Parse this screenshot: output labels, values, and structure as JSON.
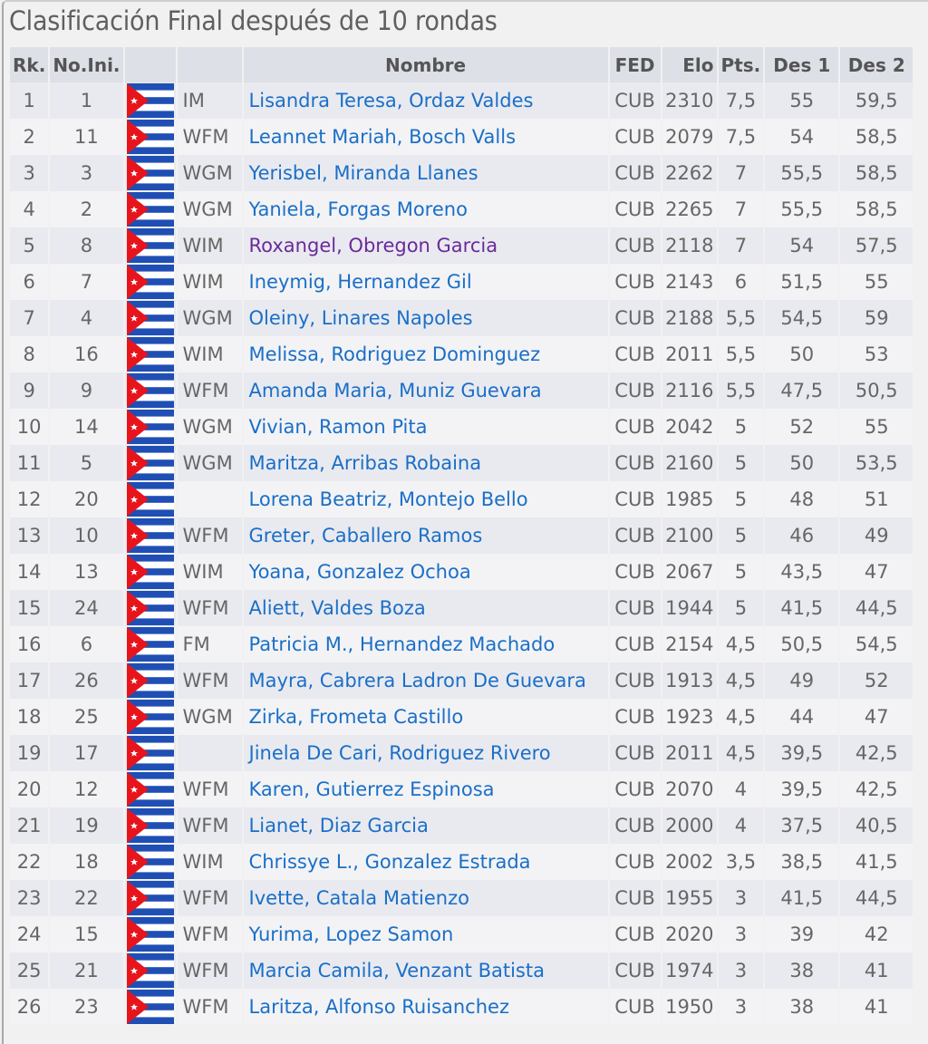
{
  "title": "Clasificación Final después de 10 rondas",
  "colors": {
    "link": "#1a6fc7",
    "visited_link": "#6a2a9a",
    "header_bg": "#dde0e6",
    "row_odd_bg": "#e9eaf0",
    "row_even_bg": "#f3f3f5",
    "flag_blue": "#1f4fb4",
    "flag_red": "#e8141c"
  },
  "table": {
    "columns": {
      "rank": "Rk.",
      "start_no": "No.Ini.",
      "flag": "",
      "title": "",
      "name": "Nombre",
      "fed": "FED",
      "elo": "Elo",
      "pts": "Pts.",
      "tb1": "Des 1",
      "tb2": "Des 2"
    },
    "rows": [
      {
        "rank": "1",
        "start_no": "1",
        "flag": "cuba-flag-icon",
        "title": "IM",
        "name": "Lisandra Teresa, Ordaz Valdes",
        "visited": false,
        "fed": "CUB",
        "elo": "2310",
        "pts": "7,5",
        "tb1": "55",
        "tb2": "59,5"
      },
      {
        "rank": "2",
        "start_no": "11",
        "flag": "cuba-flag-icon",
        "title": "WFM",
        "name": "Leannet Mariah, Bosch Valls",
        "visited": false,
        "fed": "CUB",
        "elo": "2079",
        "pts": "7,5",
        "tb1": "54",
        "tb2": "58,5"
      },
      {
        "rank": "3",
        "start_no": "3",
        "flag": "cuba-flag-icon",
        "title": "WGM",
        "name": "Yerisbel, Miranda Llanes",
        "visited": false,
        "fed": "CUB",
        "elo": "2262",
        "pts": "7",
        "tb1": "55,5",
        "tb2": "58,5"
      },
      {
        "rank": "4",
        "start_no": "2",
        "flag": "cuba-flag-icon",
        "title": "WGM",
        "name": "Yaniela, Forgas Moreno",
        "visited": false,
        "fed": "CUB",
        "elo": "2265",
        "pts": "7",
        "tb1": "55,5",
        "tb2": "58,5"
      },
      {
        "rank": "5",
        "start_no": "8",
        "flag": "cuba-flag-icon",
        "title": "WIM",
        "name": "Roxangel, Obregon Garcia",
        "visited": true,
        "fed": "CUB",
        "elo": "2118",
        "pts": "7",
        "tb1": "54",
        "tb2": "57,5"
      },
      {
        "rank": "6",
        "start_no": "7",
        "flag": "cuba-flag-icon",
        "title": "WIM",
        "name": "Ineymig, Hernandez Gil",
        "visited": false,
        "fed": "CUB",
        "elo": "2143",
        "pts": "6",
        "tb1": "51,5",
        "tb2": "55"
      },
      {
        "rank": "7",
        "start_no": "4",
        "flag": "cuba-flag-icon",
        "title": "WGM",
        "name": "Oleiny, Linares Napoles",
        "visited": false,
        "fed": "CUB",
        "elo": "2188",
        "pts": "5,5",
        "tb1": "54,5",
        "tb2": "59"
      },
      {
        "rank": "8",
        "start_no": "16",
        "flag": "cuba-flag-icon",
        "title": "WIM",
        "name": "Melissa, Rodriguez Dominguez",
        "visited": false,
        "fed": "CUB",
        "elo": "2011",
        "pts": "5,5",
        "tb1": "50",
        "tb2": "53"
      },
      {
        "rank": "9",
        "start_no": "9",
        "flag": "cuba-flag-icon",
        "title": "WFM",
        "name": "Amanda Maria, Muniz Guevara",
        "visited": false,
        "fed": "CUB",
        "elo": "2116",
        "pts": "5,5",
        "tb1": "47,5",
        "tb2": "50,5"
      },
      {
        "rank": "10",
        "start_no": "14",
        "flag": "cuba-flag-icon",
        "title": "WGM",
        "name": "Vivian, Ramon Pita",
        "visited": false,
        "fed": "CUB",
        "elo": "2042",
        "pts": "5",
        "tb1": "52",
        "tb2": "55"
      },
      {
        "rank": "11",
        "start_no": "5",
        "flag": "cuba-flag-icon",
        "title": "WGM",
        "name": "Maritza, Arribas Robaina",
        "visited": false,
        "fed": "CUB",
        "elo": "2160",
        "pts": "5",
        "tb1": "50",
        "tb2": "53,5"
      },
      {
        "rank": "12",
        "start_no": "20",
        "flag": "cuba-flag-icon",
        "title": "",
        "name": "Lorena Beatriz, Montejo Bello",
        "visited": false,
        "fed": "CUB",
        "elo": "1985",
        "pts": "5",
        "tb1": "48",
        "tb2": "51"
      },
      {
        "rank": "13",
        "start_no": "10",
        "flag": "cuba-flag-icon",
        "title": "WFM",
        "name": "Greter, Caballero Ramos",
        "visited": false,
        "fed": "CUB",
        "elo": "2100",
        "pts": "5",
        "tb1": "46",
        "tb2": "49"
      },
      {
        "rank": "14",
        "start_no": "13",
        "flag": "cuba-flag-icon",
        "title": "WIM",
        "name": "Yoana, Gonzalez Ochoa",
        "visited": false,
        "fed": "CUB",
        "elo": "2067",
        "pts": "5",
        "tb1": "43,5",
        "tb2": "47"
      },
      {
        "rank": "15",
        "start_no": "24",
        "flag": "cuba-flag-icon",
        "title": "WFM",
        "name": "Aliett, Valdes Boza",
        "visited": false,
        "fed": "CUB",
        "elo": "1944",
        "pts": "5",
        "tb1": "41,5",
        "tb2": "44,5"
      },
      {
        "rank": "16",
        "start_no": "6",
        "flag": "cuba-flag-icon",
        "title": "FM",
        "name": "Patricia M., Hernandez Machado",
        "visited": false,
        "fed": "CUB",
        "elo": "2154",
        "pts": "4,5",
        "tb1": "50,5",
        "tb2": "54,5"
      },
      {
        "rank": "17",
        "start_no": "26",
        "flag": "cuba-flag-icon",
        "title": "WFM",
        "name": "Mayra, Cabrera Ladron De Guevara",
        "visited": false,
        "fed": "CUB",
        "elo": "1913",
        "pts": "4,5",
        "tb1": "49",
        "tb2": "52"
      },
      {
        "rank": "18",
        "start_no": "25",
        "flag": "cuba-flag-icon",
        "title": "WGM",
        "name": "Zirka, Frometa Castillo",
        "visited": false,
        "fed": "CUB",
        "elo": "1923",
        "pts": "4,5",
        "tb1": "44",
        "tb2": "47"
      },
      {
        "rank": "19",
        "start_no": "17",
        "flag": "cuba-flag-icon",
        "title": "",
        "name": "Jinela De Cari, Rodriguez Rivero",
        "visited": false,
        "fed": "CUB",
        "elo": "2011",
        "pts": "4,5",
        "tb1": "39,5",
        "tb2": "42,5"
      },
      {
        "rank": "20",
        "start_no": "12",
        "flag": "cuba-flag-icon",
        "title": "WFM",
        "name": "Karen, Gutierrez Espinosa",
        "visited": false,
        "fed": "CUB",
        "elo": "2070",
        "pts": "4",
        "tb1": "39,5",
        "tb2": "42,5"
      },
      {
        "rank": "21",
        "start_no": "19",
        "flag": "cuba-flag-icon",
        "title": "WFM",
        "name": "Lianet, Diaz Garcia",
        "visited": false,
        "fed": "CUB",
        "elo": "2000",
        "pts": "4",
        "tb1": "37,5",
        "tb2": "40,5"
      },
      {
        "rank": "22",
        "start_no": "18",
        "flag": "cuba-flag-icon",
        "title": "WIM",
        "name": "Chrissye L., Gonzalez Estrada",
        "visited": false,
        "fed": "CUB",
        "elo": "2002",
        "pts": "3,5",
        "tb1": "38,5",
        "tb2": "41,5"
      },
      {
        "rank": "23",
        "start_no": "22",
        "flag": "cuba-flag-icon",
        "title": "WFM",
        "name": "Ivette, Catala Matienzo",
        "visited": false,
        "fed": "CUB",
        "elo": "1955",
        "pts": "3",
        "tb1": "41,5",
        "tb2": "44,5"
      },
      {
        "rank": "24",
        "start_no": "15",
        "flag": "cuba-flag-icon",
        "title": "WFM",
        "name": "Yurima, Lopez Samon",
        "visited": false,
        "fed": "CUB",
        "elo": "2020",
        "pts": "3",
        "tb1": "39",
        "tb2": "42"
      },
      {
        "rank": "25",
        "start_no": "21",
        "flag": "cuba-flag-icon",
        "title": "WFM",
        "name": "Marcia Camila, Venzant Batista",
        "visited": false,
        "fed": "CUB",
        "elo": "1974",
        "pts": "3",
        "tb1": "38",
        "tb2": "41"
      },
      {
        "rank": "26",
        "start_no": "23",
        "flag": "cuba-flag-icon",
        "title": "WFM",
        "name": "Laritza, Alfonso Ruisanchez",
        "visited": false,
        "fed": "CUB",
        "elo": "1950",
        "pts": "3",
        "tb1": "38",
        "tb2": "41"
      }
    ]
  }
}
